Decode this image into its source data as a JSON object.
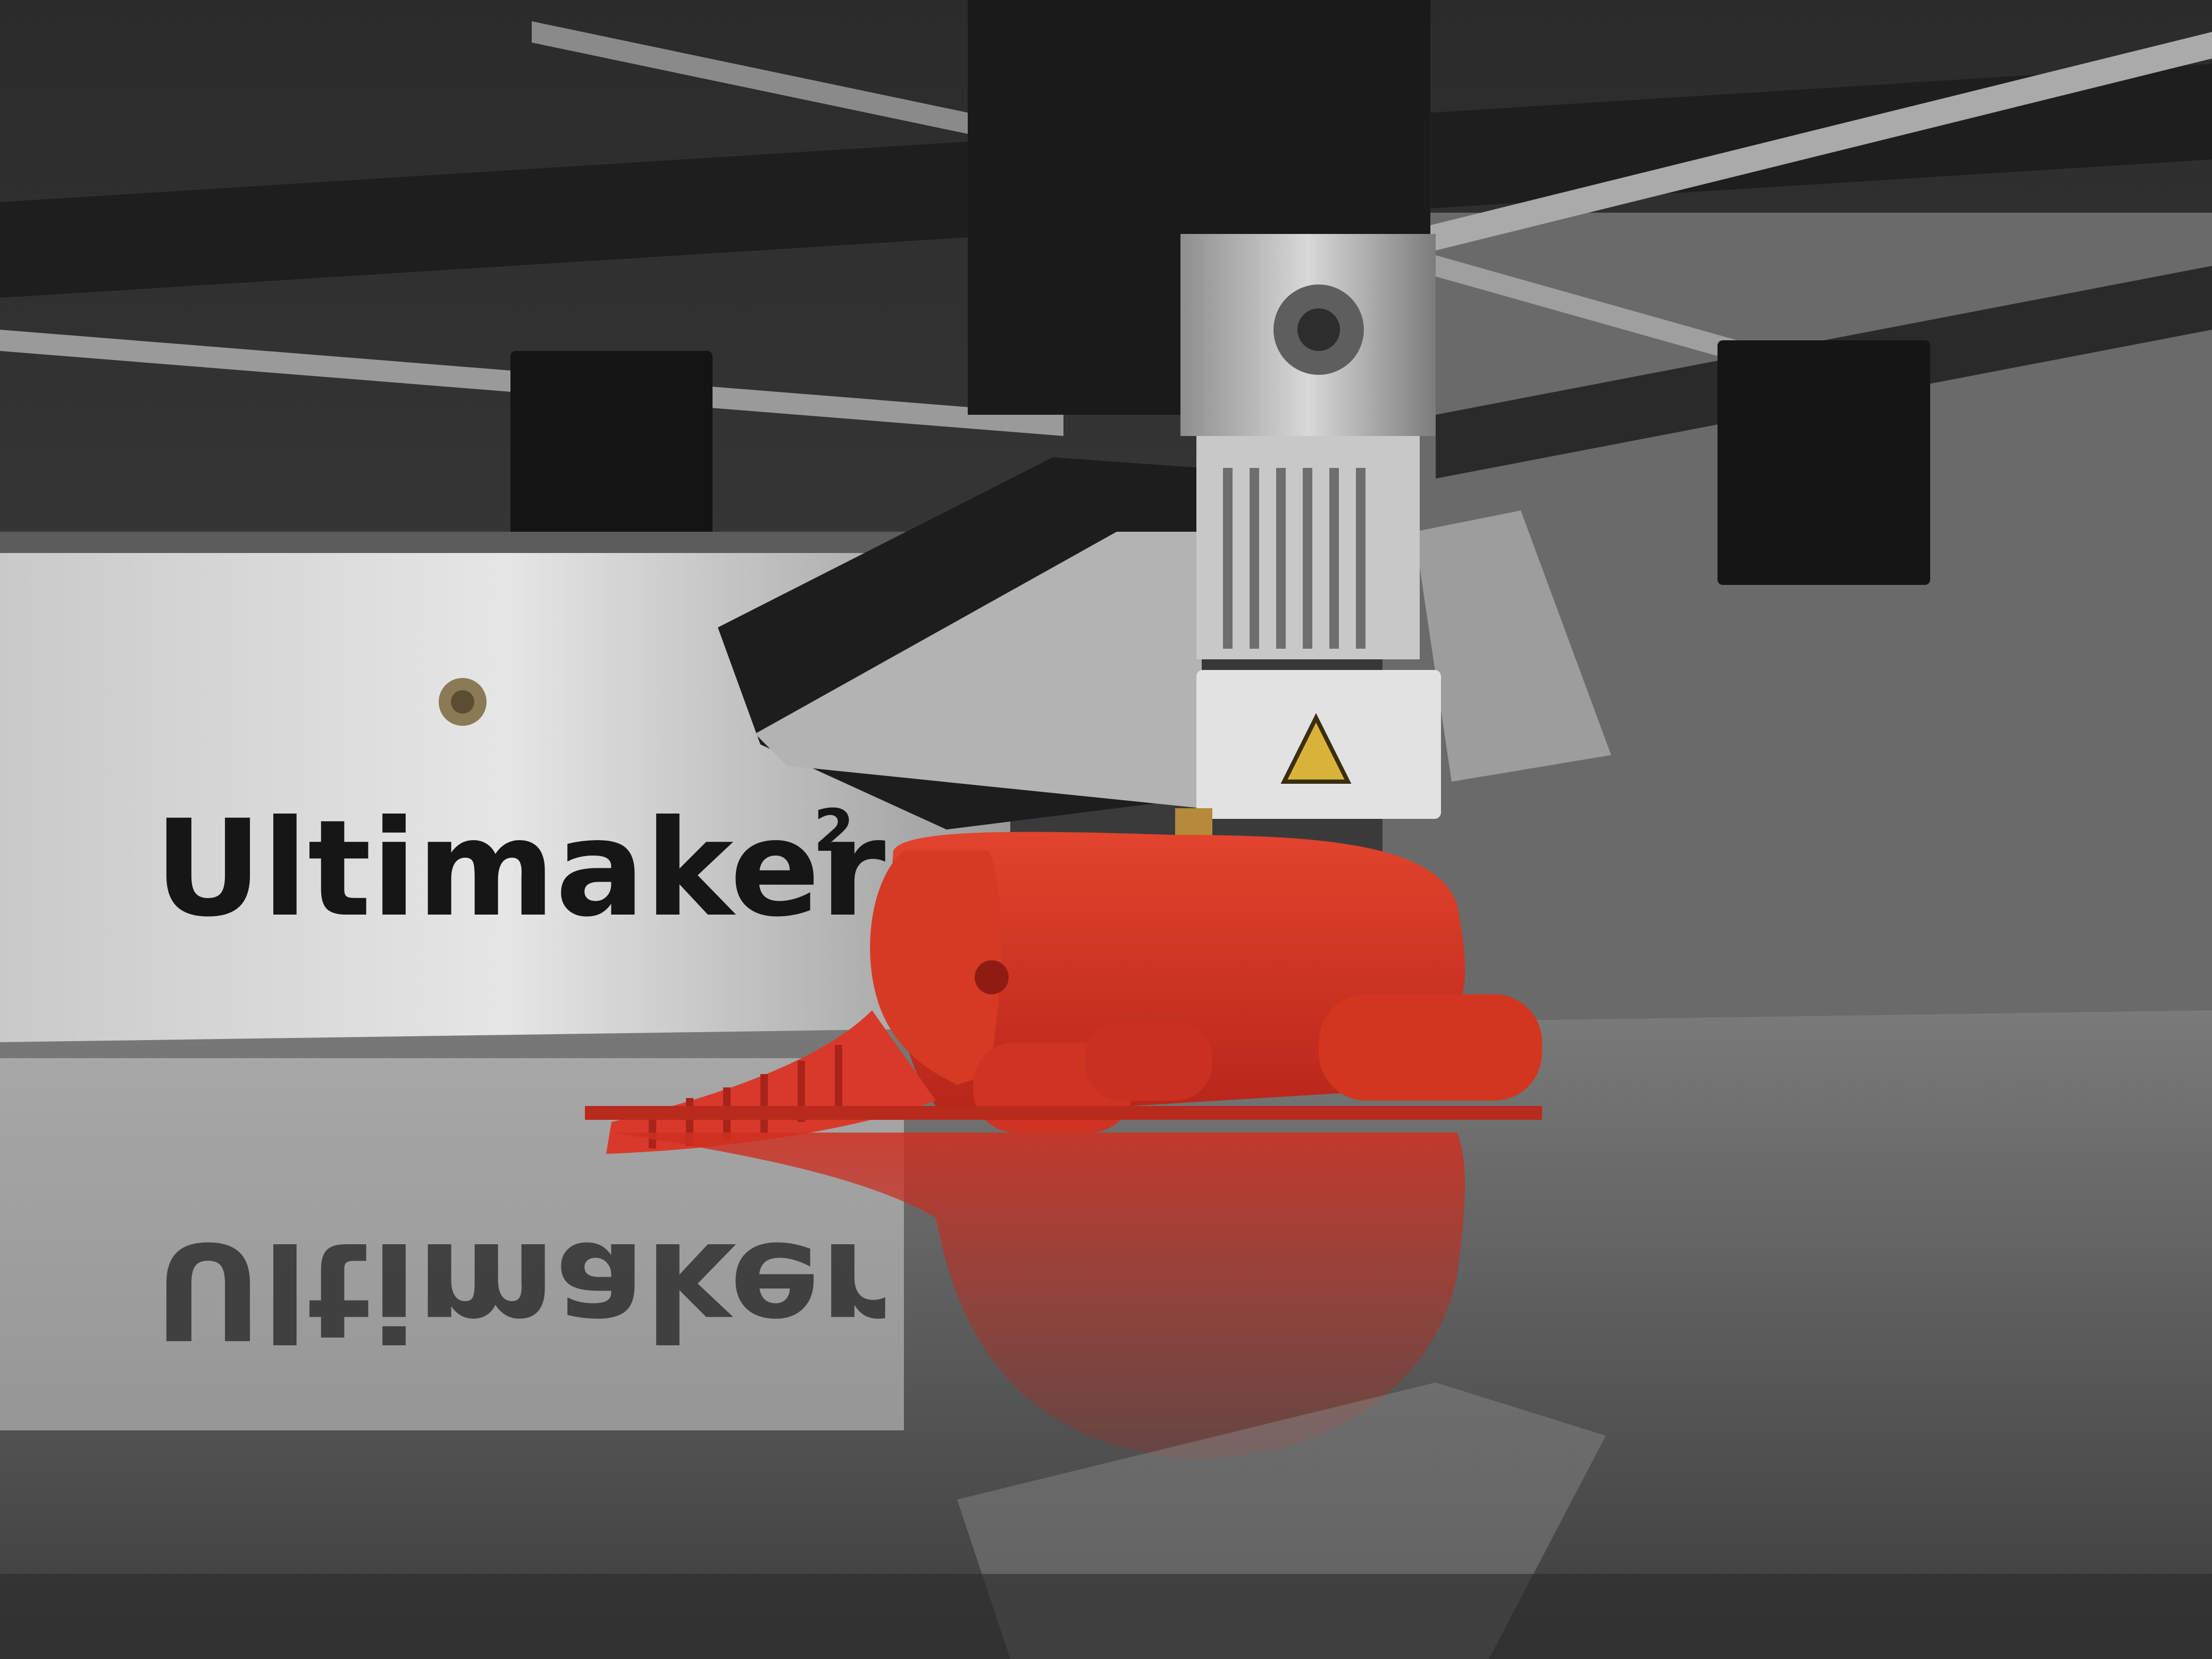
{
  "brand": {
    "name": "Ultimaker",
    "superscript": "2",
    "mirrored": "Ultimaker"
  },
  "colors": {
    "filament": "#d8321f",
    "filament_shadow": "#9e1f12",
    "panel": "#d6d6d6",
    "frame_dark": "#1c1c1c",
    "metal": "#b9b9b9",
    "glass": "#5a5a5a",
    "warning_label": "#d9b23a"
  },
  "icons": {
    "warning": "hot-surface-warning-icon"
  },
  "objects": {
    "printed_model": "red-elephant-print",
    "print_head": "print-head"
  }
}
